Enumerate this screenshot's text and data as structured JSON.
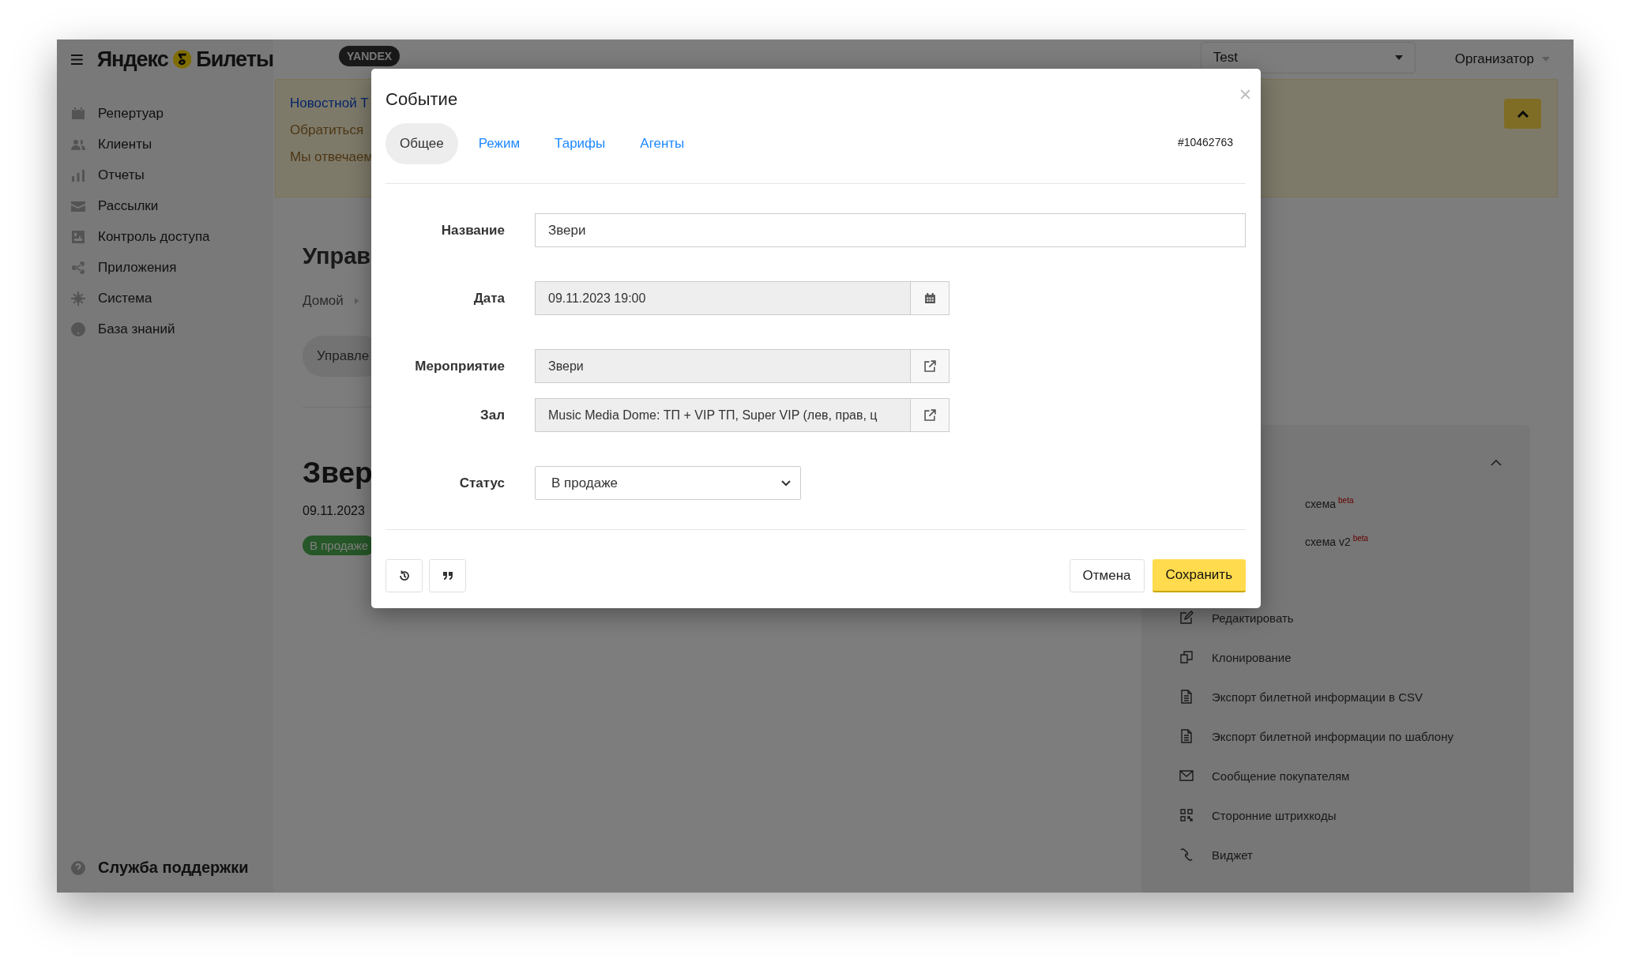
{
  "logo": {
    "left": "Яндекс",
    "right": "Билеты"
  },
  "header": {
    "badge": "YANDEX",
    "account": "Test",
    "role": "Организатор"
  },
  "sidebar": {
    "items": [
      "Репертуар",
      "Клиенты",
      "Отчеты",
      "Рассылки",
      "Контроль доступа",
      "Приложения",
      "Система",
      "База знаний"
    ],
    "support": "Служба поддержки"
  },
  "notice": {
    "lines": [
      {
        "kind": "link",
        "text": "Новостной Т"
      },
      {
        "kind": "text",
        "text": "Обратиться"
      },
      {
        "kind": "text",
        "text": "Мы отвечаем"
      }
    ]
  },
  "page": {
    "title": "Управ",
    "breadcrumb": "Домой",
    "tab": "Управле",
    "event_title": "Звер",
    "event_date": "09.11.2023",
    "status_badge": "В продаже"
  },
  "side_panel": {
    "expanded": true,
    "seat_maps": [
      {
        "label": "схема",
        "tag": "beta"
      },
      {
        "label": "схема v2",
        "tag": "beta"
      }
    ],
    "actions": [
      "Редактировать",
      "Клонирование",
      "Экспорт билетной информации в CSV",
      "Экспорт билетной информации по шаблону",
      "Сообщение покупателям",
      "Сторонние штрихкоды",
      "Виджет"
    ]
  },
  "dialog": {
    "title": "Событие",
    "tabs": [
      {
        "label": "Общее",
        "selected": true
      },
      {
        "label": "Режим",
        "selected": false
      },
      {
        "label": "Тарифы",
        "selected": false
      },
      {
        "label": "Агенты",
        "selected": false
      }
    ],
    "event_id": "#10462763",
    "fields": [
      {
        "kind": "text",
        "label": "Название",
        "value": "Звери"
      },
      {
        "kind": "date",
        "label": "Дата",
        "value": "09.11.2023 19:00"
      },
      {
        "kind": "link",
        "label": "Мероприятие",
        "value": "Звери"
      },
      {
        "kind": "link",
        "label": "Зал",
        "value": "Music Media Dome: ТП + VIP ТП, Super VIP (лев, прав, ц"
      },
      {
        "kind": "select",
        "label": "Статус",
        "value": "В продаже"
      }
    ],
    "buttons": {
      "cancel": "Отмена",
      "save": "Сохранить"
    }
  }
}
